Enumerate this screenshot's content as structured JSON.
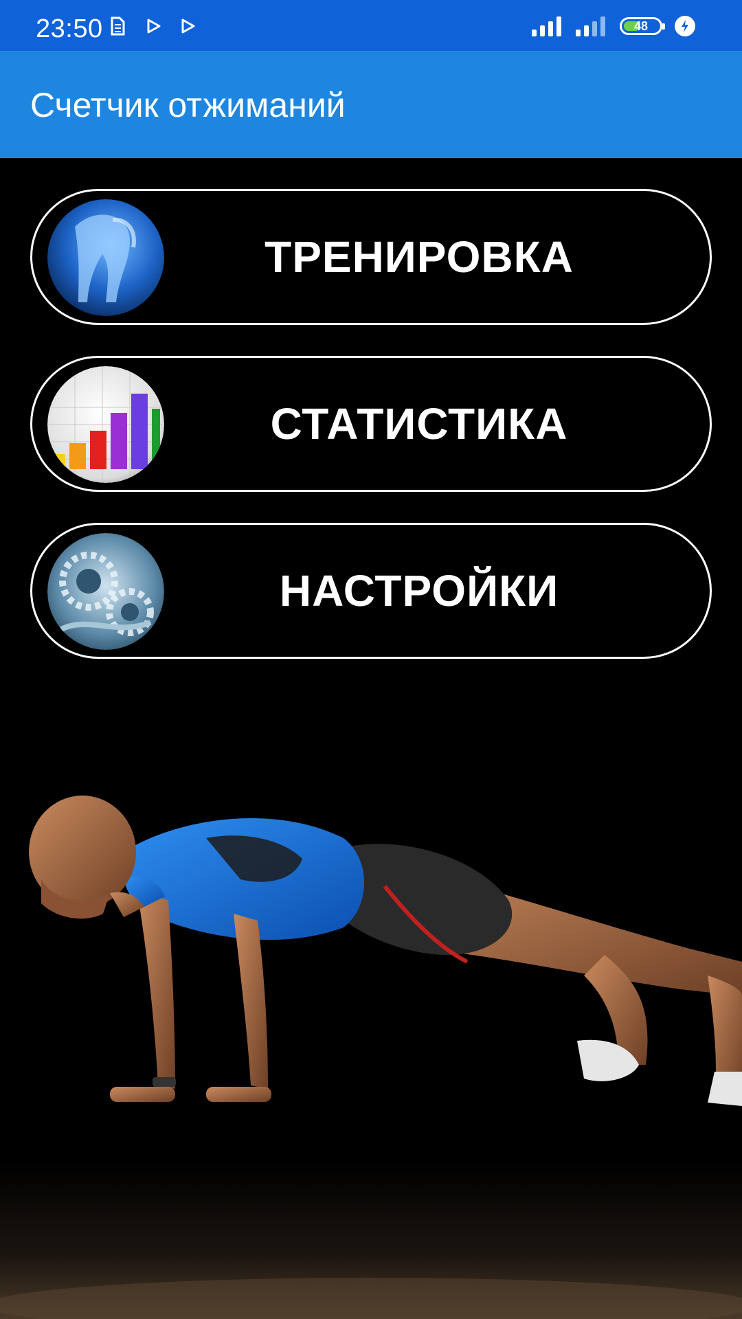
{
  "status_bar": {
    "time": "23:50",
    "battery_level": "48",
    "battery_fraction": 0.48,
    "icons": [
      "sim-icon",
      "play-store-icon",
      "play-store-icon",
      "signal-icon",
      "signal-icon",
      "battery-icon",
      "charging-icon"
    ]
  },
  "app_bar": {
    "title": "Счетчик отжиманий"
  },
  "menu": {
    "items": [
      {
        "label": "ТРЕНИРОВКА",
        "icon": "pushup-photo-icon"
      },
      {
        "label": "СТАТИСТИКА",
        "icon": "bar-chart-icon"
      },
      {
        "label": "НАСТРОЙКИ",
        "icon": "gears-icon"
      }
    ]
  },
  "colors": {
    "status_bar": "#0f62d8",
    "app_bar": "#1f86e0",
    "background": "#000000",
    "button_border": "#ffffff",
    "battery_fill": "#6fd14a"
  }
}
